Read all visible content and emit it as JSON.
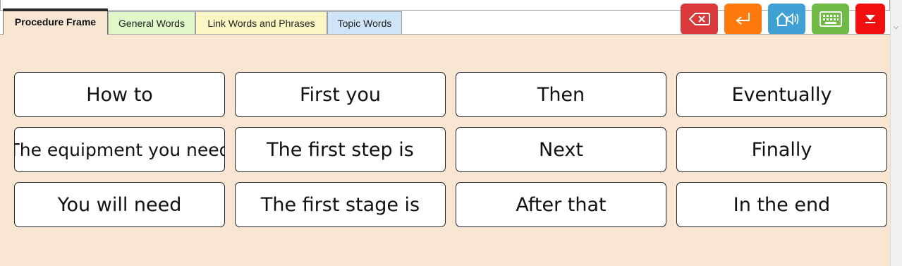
{
  "tabs": [
    {
      "label": "Procedure Frame",
      "active": true
    },
    {
      "label": "General Words"
    },
    {
      "label": "Link Words and Phrases"
    },
    {
      "label": "Topic Words"
    }
  ],
  "toolbar": [
    {
      "icon": "backspace-icon",
      "color": "#d9393a"
    },
    {
      "icon": "enter-icon",
      "color": "#ff7a0c"
    },
    {
      "icon": "speak-icon",
      "color": "#3fa1d3"
    },
    {
      "icon": "keyboard-icon",
      "color": "#6fbb45"
    },
    {
      "icon": "collapse-icon",
      "color": "#f30f10"
    }
  ],
  "colors": {
    "panel_bg": "#f9e6d2",
    "tab_general": "#dff7c9",
    "tab_link": "#fbf6c4",
    "tab_topic": "#cfe4f8"
  },
  "words": [
    [
      "How to",
      "First you",
      "Then",
      "Eventually"
    ],
    [
      "The equipment you need",
      "The first step is",
      "Next",
      "Finally"
    ],
    [
      "You will need",
      "The first stage is",
      "After that",
      "In the end"
    ]
  ]
}
